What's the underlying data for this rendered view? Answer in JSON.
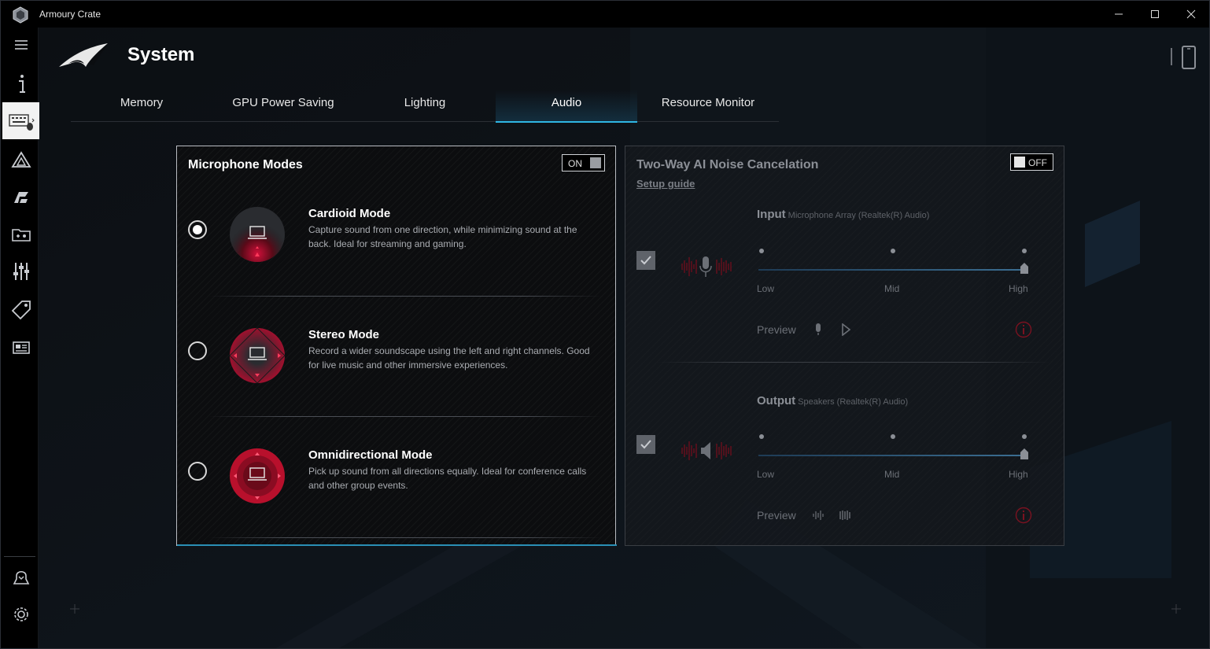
{
  "window": {
    "title": "Armoury Crate"
  },
  "header": {
    "title": "System"
  },
  "tabs": [
    {
      "label": "Memory"
    },
    {
      "label": "GPU Power Saving"
    },
    {
      "label": "Lighting"
    },
    {
      "label": "Audio"
    },
    {
      "label": "Resource Monitor"
    }
  ],
  "active_tab": "Audio",
  "sidebar": {
    "items": [
      {
        "icon": "hamburger-menu-icon"
      },
      {
        "icon": "info-icon"
      },
      {
        "icon": "keyboard-device-icon",
        "active": true
      },
      {
        "icon": "aura-sync-icon"
      },
      {
        "icon": "game-profile-icon"
      },
      {
        "icon": "game-library-icon"
      },
      {
        "icon": "mixer-icon"
      },
      {
        "icon": "deals-tag-icon"
      },
      {
        "icon": "news-icon"
      },
      {
        "icon": "user-center-icon"
      },
      {
        "icon": "settings-gear-icon"
      }
    ]
  },
  "microphone_modes": {
    "title": "Microphone Modes",
    "toggle": "ON",
    "modes": [
      {
        "name": "Cardioid Mode",
        "description": "Capture sound from one direction, while minimizing sound at the back. Ideal for streaming and gaming.",
        "selected": true
      },
      {
        "name": "Stereo Mode",
        "description": "Record a wider soundscape using the left and right channels. Good for live music and other immersive experiences.",
        "selected": false
      },
      {
        "name": "Omnidirectional Mode",
        "description": "Pick up sound from all directions equally. Ideal for conference calls and other group events.",
        "selected": false
      }
    ]
  },
  "noise_cancelation": {
    "title": "Two-Way AI Noise Cancelation",
    "toggle": "OFF",
    "setup_guide": "Setup guide",
    "input": {
      "label": "Input",
      "device": "Microphone Array (Realtek(R) Audio)",
      "checked": true,
      "levels": [
        "Low",
        "Mid",
        "High"
      ],
      "level_value": "High",
      "preview": "Preview"
    },
    "output": {
      "label": "Output",
      "device": "Speakers (Realtek(R) Audio)",
      "checked": true,
      "levels": [
        "Low",
        "Mid",
        "High"
      ],
      "level_value": "High",
      "preview": "Preview"
    }
  },
  "colors": {
    "accent_red": "#c8102e",
    "accent_blue": "#2fb6e3",
    "background": "#0b0d10"
  }
}
